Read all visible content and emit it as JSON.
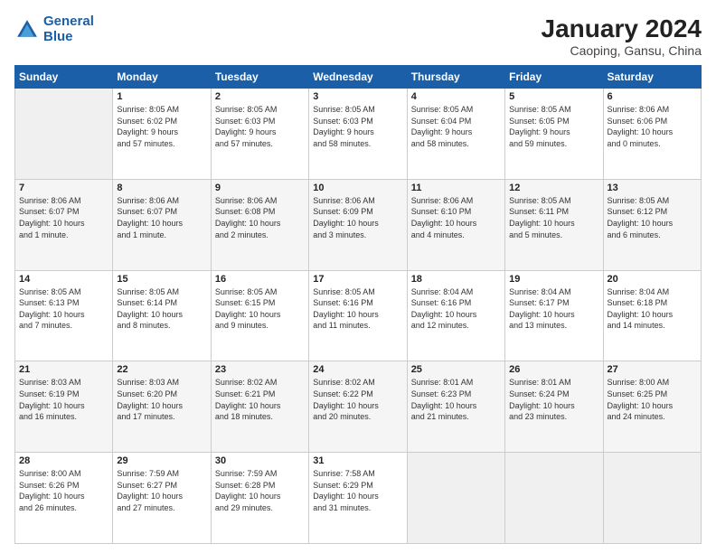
{
  "header": {
    "logo_line1": "General",
    "logo_line2": "Blue",
    "month": "January 2024",
    "location": "Caoping, Gansu, China"
  },
  "weekdays": [
    "Sunday",
    "Monday",
    "Tuesday",
    "Wednesday",
    "Thursday",
    "Friday",
    "Saturday"
  ],
  "weeks": [
    [
      {
        "day": "",
        "info": ""
      },
      {
        "day": "1",
        "info": "Sunrise: 8:05 AM\nSunset: 6:02 PM\nDaylight: 9 hours\nand 57 minutes."
      },
      {
        "day": "2",
        "info": "Sunrise: 8:05 AM\nSunset: 6:03 PM\nDaylight: 9 hours\nand 57 minutes."
      },
      {
        "day": "3",
        "info": "Sunrise: 8:05 AM\nSunset: 6:03 PM\nDaylight: 9 hours\nand 58 minutes."
      },
      {
        "day": "4",
        "info": "Sunrise: 8:05 AM\nSunset: 6:04 PM\nDaylight: 9 hours\nand 58 minutes."
      },
      {
        "day": "5",
        "info": "Sunrise: 8:05 AM\nSunset: 6:05 PM\nDaylight: 9 hours\nand 59 minutes."
      },
      {
        "day": "6",
        "info": "Sunrise: 8:06 AM\nSunset: 6:06 PM\nDaylight: 10 hours\nand 0 minutes."
      }
    ],
    [
      {
        "day": "7",
        "info": "Sunrise: 8:06 AM\nSunset: 6:07 PM\nDaylight: 10 hours\nand 1 minute."
      },
      {
        "day": "8",
        "info": "Sunrise: 8:06 AM\nSunset: 6:07 PM\nDaylight: 10 hours\nand 1 minute."
      },
      {
        "day": "9",
        "info": "Sunrise: 8:06 AM\nSunset: 6:08 PM\nDaylight: 10 hours\nand 2 minutes."
      },
      {
        "day": "10",
        "info": "Sunrise: 8:06 AM\nSunset: 6:09 PM\nDaylight: 10 hours\nand 3 minutes."
      },
      {
        "day": "11",
        "info": "Sunrise: 8:06 AM\nSunset: 6:10 PM\nDaylight: 10 hours\nand 4 minutes."
      },
      {
        "day": "12",
        "info": "Sunrise: 8:05 AM\nSunset: 6:11 PM\nDaylight: 10 hours\nand 5 minutes."
      },
      {
        "day": "13",
        "info": "Sunrise: 8:05 AM\nSunset: 6:12 PM\nDaylight: 10 hours\nand 6 minutes."
      }
    ],
    [
      {
        "day": "14",
        "info": "Sunrise: 8:05 AM\nSunset: 6:13 PM\nDaylight: 10 hours\nand 7 minutes."
      },
      {
        "day": "15",
        "info": "Sunrise: 8:05 AM\nSunset: 6:14 PM\nDaylight: 10 hours\nand 8 minutes."
      },
      {
        "day": "16",
        "info": "Sunrise: 8:05 AM\nSunset: 6:15 PM\nDaylight: 10 hours\nand 9 minutes."
      },
      {
        "day": "17",
        "info": "Sunrise: 8:05 AM\nSunset: 6:16 PM\nDaylight: 10 hours\nand 11 minutes."
      },
      {
        "day": "18",
        "info": "Sunrise: 8:04 AM\nSunset: 6:16 PM\nDaylight: 10 hours\nand 12 minutes."
      },
      {
        "day": "19",
        "info": "Sunrise: 8:04 AM\nSunset: 6:17 PM\nDaylight: 10 hours\nand 13 minutes."
      },
      {
        "day": "20",
        "info": "Sunrise: 8:04 AM\nSunset: 6:18 PM\nDaylight: 10 hours\nand 14 minutes."
      }
    ],
    [
      {
        "day": "21",
        "info": "Sunrise: 8:03 AM\nSunset: 6:19 PM\nDaylight: 10 hours\nand 16 minutes."
      },
      {
        "day": "22",
        "info": "Sunrise: 8:03 AM\nSunset: 6:20 PM\nDaylight: 10 hours\nand 17 minutes."
      },
      {
        "day": "23",
        "info": "Sunrise: 8:02 AM\nSunset: 6:21 PM\nDaylight: 10 hours\nand 18 minutes."
      },
      {
        "day": "24",
        "info": "Sunrise: 8:02 AM\nSunset: 6:22 PM\nDaylight: 10 hours\nand 20 minutes."
      },
      {
        "day": "25",
        "info": "Sunrise: 8:01 AM\nSunset: 6:23 PM\nDaylight: 10 hours\nand 21 minutes."
      },
      {
        "day": "26",
        "info": "Sunrise: 8:01 AM\nSunset: 6:24 PM\nDaylight: 10 hours\nand 23 minutes."
      },
      {
        "day": "27",
        "info": "Sunrise: 8:00 AM\nSunset: 6:25 PM\nDaylight: 10 hours\nand 24 minutes."
      }
    ],
    [
      {
        "day": "28",
        "info": "Sunrise: 8:00 AM\nSunset: 6:26 PM\nDaylight: 10 hours\nand 26 minutes."
      },
      {
        "day": "29",
        "info": "Sunrise: 7:59 AM\nSunset: 6:27 PM\nDaylight: 10 hours\nand 27 minutes."
      },
      {
        "day": "30",
        "info": "Sunrise: 7:59 AM\nSunset: 6:28 PM\nDaylight: 10 hours\nand 29 minutes."
      },
      {
        "day": "31",
        "info": "Sunrise: 7:58 AM\nSunset: 6:29 PM\nDaylight: 10 hours\nand 31 minutes."
      },
      {
        "day": "",
        "info": ""
      },
      {
        "day": "",
        "info": ""
      },
      {
        "day": "",
        "info": ""
      }
    ]
  ]
}
